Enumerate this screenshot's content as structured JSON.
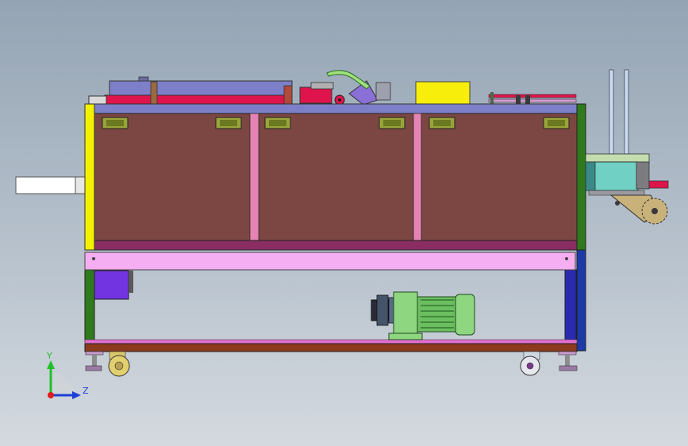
{
  "viewport": {
    "background_top": "#94a4b4",
    "background_bottom": "#d4d9df"
  },
  "triad": {
    "y_label": "Y",
    "z_label": "Z",
    "y_color": "#1fbf2a",
    "z_color": "#1f3fd6",
    "x_color": "#e21b1b",
    "icon": "coordinate-triad-icon"
  },
  "colors": {
    "panel": "#7c4742",
    "top_plate": "#7d7fc8",
    "frame_yellow": "#f3f000",
    "frame_green": "#2f7a1c",
    "frame_blue": "#1c3aa8",
    "rail_pink": "#f6aef2",
    "base_brown": "#8b3a1e",
    "motor_green": "#8ed67f",
    "bracket_cyan": "#6fd0c3",
    "red_belt": "#e0144c",
    "yellow_box": "#f7ef0b"
  }
}
